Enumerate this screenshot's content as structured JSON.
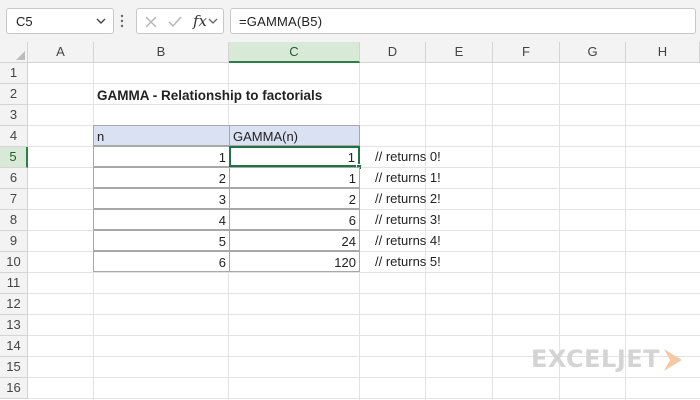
{
  "formula_bar": {
    "name_box": "C5",
    "fx_label": "fx",
    "formula": "=GAMMA(B5)"
  },
  "columns": [
    "A",
    "B",
    "C",
    "D",
    "E",
    "F",
    "G",
    "H"
  ],
  "rows": [
    "1",
    "2",
    "3",
    "4",
    "5",
    "6",
    "7",
    "8",
    "9",
    "10",
    "11",
    "12",
    "13",
    "14",
    "15",
    "16"
  ],
  "sheet": {
    "title": "GAMMA - Relationship to factorials",
    "header": {
      "n": "n",
      "gamma": "GAMMA(n)"
    },
    "table": [
      {
        "n": "1",
        "gamma": "1",
        "note": "// returns 0!"
      },
      {
        "n": "2",
        "gamma": "1",
        "note": "// returns 1!"
      },
      {
        "n": "3",
        "gamma": "2",
        "note": "// returns 2!"
      },
      {
        "n": "4",
        "gamma": "6",
        "note": "// returns 3!"
      },
      {
        "n": "5",
        "gamma": "24",
        "note": "// returns 4!"
      },
      {
        "n": "6",
        "gamma": "120",
        "note": "// returns 5!"
      }
    ]
  },
  "watermark": "EXCELJET",
  "colors": {
    "accent_green": "#217346",
    "header_fill": "#d9e1f2",
    "logo_orange": "#f5c9a8"
  }
}
